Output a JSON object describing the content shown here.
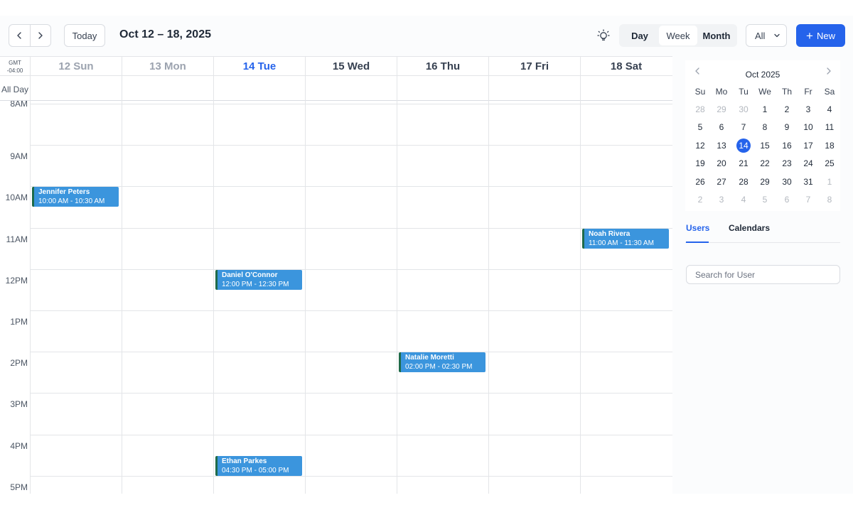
{
  "toolbar": {
    "today_label": "Today",
    "range_title": "Oct 12 – 18, 2025",
    "views": [
      {
        "label": "Day",
        "active": false
      },
      {
        "label": "Week",
        "active": true
      },
      {
        "label": "Month",
        "active": false
      }
    ],
    "filter_value": "All",
    "new_label": "New",
    "accent_color": "#2563eb"
  },
  "calendar": {
    "timezone_line1": "GMT",
    "timezone_line2": "-04:00",
    "all_day_label": "All Day",
    "days": [
      {
        "label": "12 Sun",
        "state": "past"
      },
      {
        "label": "13 Mon",
        "state": "past"
      },
      {
        "label": "14 Tue",
        "state": "today"
      },
      {
        "label": "15 Wed",
        "state": "future"
      },
      {
        "label": "16 Thu",
        "state": "future"
      },
      {
        "label": "17 Fri",
        "state": "future"
      },
      {
        "label": "18 Sat",
        "state": "future"
      }
    ],
    "hours": [
      "8AM",
      "9AM",
      "10AM",
      "11AM",
      "12PM",
      "1PM",
      "2PM",
      "3PM",
      "4PM",
      "5PM"
    ],
    "events": [
      {
        "name": "Jennifer Peters",
        "time": "10:00 AM - 10:30 AM",
        "day": 0,
        "start_hour": 10.0
      },
      {
        "name": "Noah Rivera",
        "time": "11:00 AM - 11:30 AM",
        "day": 6,
        "start_hour": 11.0
      },
      {
        "name": "Daniel O'Connor",
        "time": "12:00 PM - 12:30 PM",
        "day": 2,
        "start_hour": 12.0
      },
      {
        "name": "Natalie Moretti",
        "time": "02:00 PM - 02:30 PM",
        "day": 4,
        "start_hour": 14.0
      },
      {
        "name": "Ethan Parkes",
        "time": "04:30 PM - 05:00 PM",
        "day": 2,
        "start_hour": 16.5
      }
    ],
    "event_color": "#3b95dd",
    "event_border_color": "#1f6b4a"
  },
  "mini_calendar": {
    "title": "Oct 2025",
    "weekdays": [
      "Su",
      "Mo",
      "Tu",
      "We",
      "Th",
      "Fr",
      "Sa"
    ],
    "weeks": [
      [
        {
          "d": "28",
          "m": true
        },
        {
          "d": "29",
          "m": true
        },
        {
          "d": "30",
          "m": true
        },
        {
          "d": "1"
        },
        {
          "d": "2"
        },
        {
          "d": "3"
        },
        {
          "d": "4"
        }
      ],
      [
        {
          "d": "5"
        },
        {
          "d": "6"
        },
        {
          "d": "7"
        },
        {
          "d": "8"
        },
        {
          "d": "9"
        },
        {
          "d": "10"
        },
        {
          "d": "11"
        }
      ],
      [
        {
          "d": "12"
        },
        {
          "d": "13"
        },
        {
          "d": "14",
          "sel": true
        },
        {
          "d": "15"
        },
        {
          "d": "16"
        },
        {
          "d": "17"
        },
        {
          "d": "18"
        }
      ],
      [
        {
          "d": "19"
        },
        {
          "d": "20"
        },
        {
          "d": "21"
        },
        {
          "d": "22"
        },
        {
          "d": "23"
        },
        {
          "d": "24"
        },
        {
          "d": "25"
        }
      ],
      [
        {
          "d": "26"
        },
        {
          "d": "27"
        },
        {
          "d": "28"
        },
        {
          "d": "29"
        },
        {
          "d": "30"
        },
        {
          "d": "31"
        },
        {
          "d": "1",
          "m": true
        }
      ],
      [
        {
          "d": "2",
          "m": true
        },
        {
          "d": "3",
          "m": true
        },
        {
          "d": "4",
          "m": true
        },
        {
          "d": "5",
          "m": true
        },
        {
          "d": "6",
          "m": true
        },
        {
          "d": "7",
          "m": true
        },
        {
          "d": "8",
          "m": true
        }
      ]
    ]
  },
  "sidebar": {
    "tabs": [
      {
        "label": "Users",
        "active": true
      },
      {
        "label": "Calendars",
        "active": false
      }
    ],
    "search_placeholder": "Search for User"
  },
  "icons": {
    "prev": "chevron-left-icon",
    "next": "chevron-right-icon",
    "theme": "lightbulb-icon",
    "dropdown": "chevron-down-icon",
    "add": "plus-icon"
  }
}
